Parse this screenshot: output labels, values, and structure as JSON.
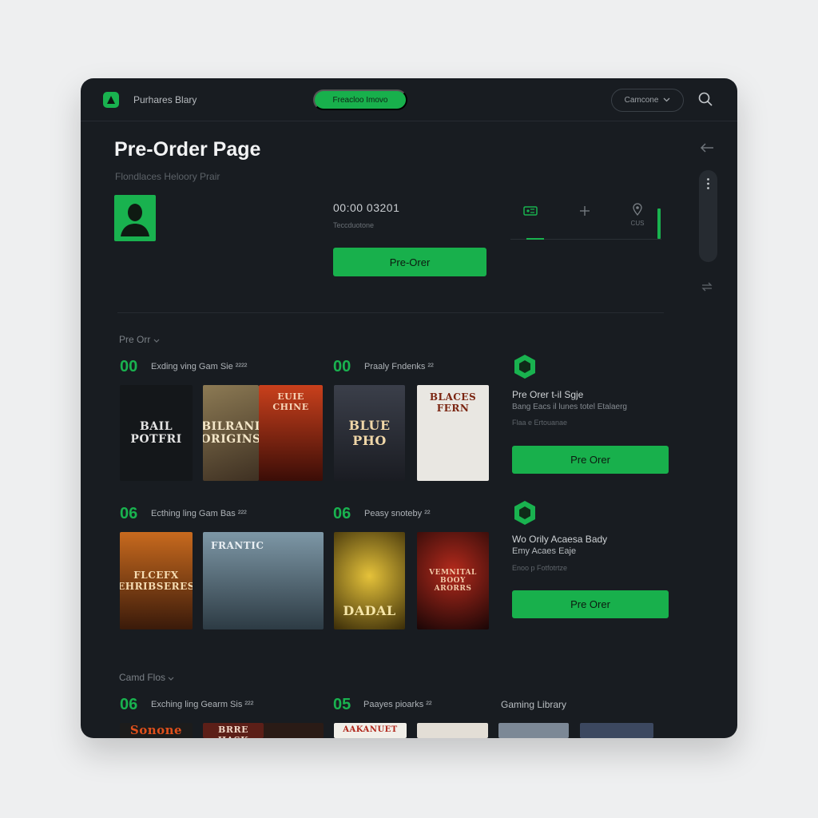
{
  "topbar": {
    "app_title": "Purhares Blary",
    "pill_label": "Freacloo Imovo",
    "select_value": "Camcone",
    "icons": [
      "logo-icon",
      "chevron-down-icon",
      "search-icon"
    ]
  },
  "header": {
    "title": "Pre-Order Page",
    "subtitle": "Flondlaces Heloory Prair"
  },
  "hero": {
    "timer": "00:00 03201",
    "timer_sub": "Teccduotone",
    "preorder_label": "Pre-Orer",
    "tabs": [
      {
        "icon": "ticket-icon",
        "label": ""
      },
      {
        "icon": "plus-icon",
        "label": ""
      },
      {
        "icon": "location-icon",
        "label": "CUS"
      }
    ]
  },
  "sections": [
    {
      "label": "Pre Orr",
      "rows": [
        {
          "left": {
            "num": "00",
            "title": "Exding ving Gam Sie ²²²²"
          },
          "right": {
            "num": "00",
            "title": "Praaly Fndenks ²²"
          },
          "covers": [
            {
              "text": "BAIL POTFRI",
              "bg": "#14171a"
            },
            {
              "text": "BILRANI ORIGINS",
              "bg": "#6b5a3c"
            },
            {
              "text": "EUIE CHINE",
              "bg": "#8a2a16"
            },
            {
              "text": "BLUE PHO",
              "bg": "#2a2d36"
            },
            {
              "text": "BLACES FERN",
              "bg": "#e9e7e2"
            }
          ],
          "panel": {
            "title": "Pre Orer t-il Sgje",
            "sub": "Bang Eacs il lunes totel Etalaerg",
            "meta": "Flaa e Ertouanae",
            "button": "Pre Orer"
          }
        },
        {
          "left": {
            "num": "06",
            "title": "Ecthing ling Gam Bas ²²²"
          },
          "right": {
            "num": "06",
            "title": "Peasy snoteby ²²"
          },
          "covers": [
            {
              "text": "FLCEFX EHRIBSERES",
              "bg": "#b4531a"
            },
            {
              "text": "FRANTIC",
              "bg": "#56707e"
            },
            {
              "text": "DADAL",
              "bg": "#a08512"
            },
            {
              "text": "VEMNITAL BOOY ARORRS",
              "bg": "#851a14"
            }
          ],
          "panel": {
            "title": "Wo Orily Acaesa Bady",
            "sub": "Emy Acaes Eaje",
            "meta": "Enoo p Fotfotrtze",
            "button": "Pre Orer"
          }
        }
      ]
    },
    {
      "label": "Camd Flos",
      "rows": [
        {
          "left": {
            "num": "06",
            "title": "Exching ling Gearm Sis ²²²"
          },
          "right": {
            "num": "05",
            "title": "Paayes pioarks ²²"
          },
          "extra_title": "Gaming Library",
          "covers": [
            {
              "text": "Sonone",
              "bg": "#1c1c1c"
            },
            {
              "text": "BRRE HASK",
              "bg": "#5c1f18"
            },
            {
              "text": "",
              "bg": "#2a1b16"
            },
            {
              "text": "AAKANUET",
              "bg": "#f1efe9"
            },
            {
              "text": "",
              "bg": "#e3ded6"
            },
            {
              "text": "",
              "bg": "#7c8896"
            },
            {
              "text": "",
              "bg": "#3c4860"
            }
          ]
        }
      ]
    }
  ],
  "colors": {
    "accent": "#19b24f",
    "panel_bg": "#181c21",
    "page_bg": "#eeeff0"
  }
}
